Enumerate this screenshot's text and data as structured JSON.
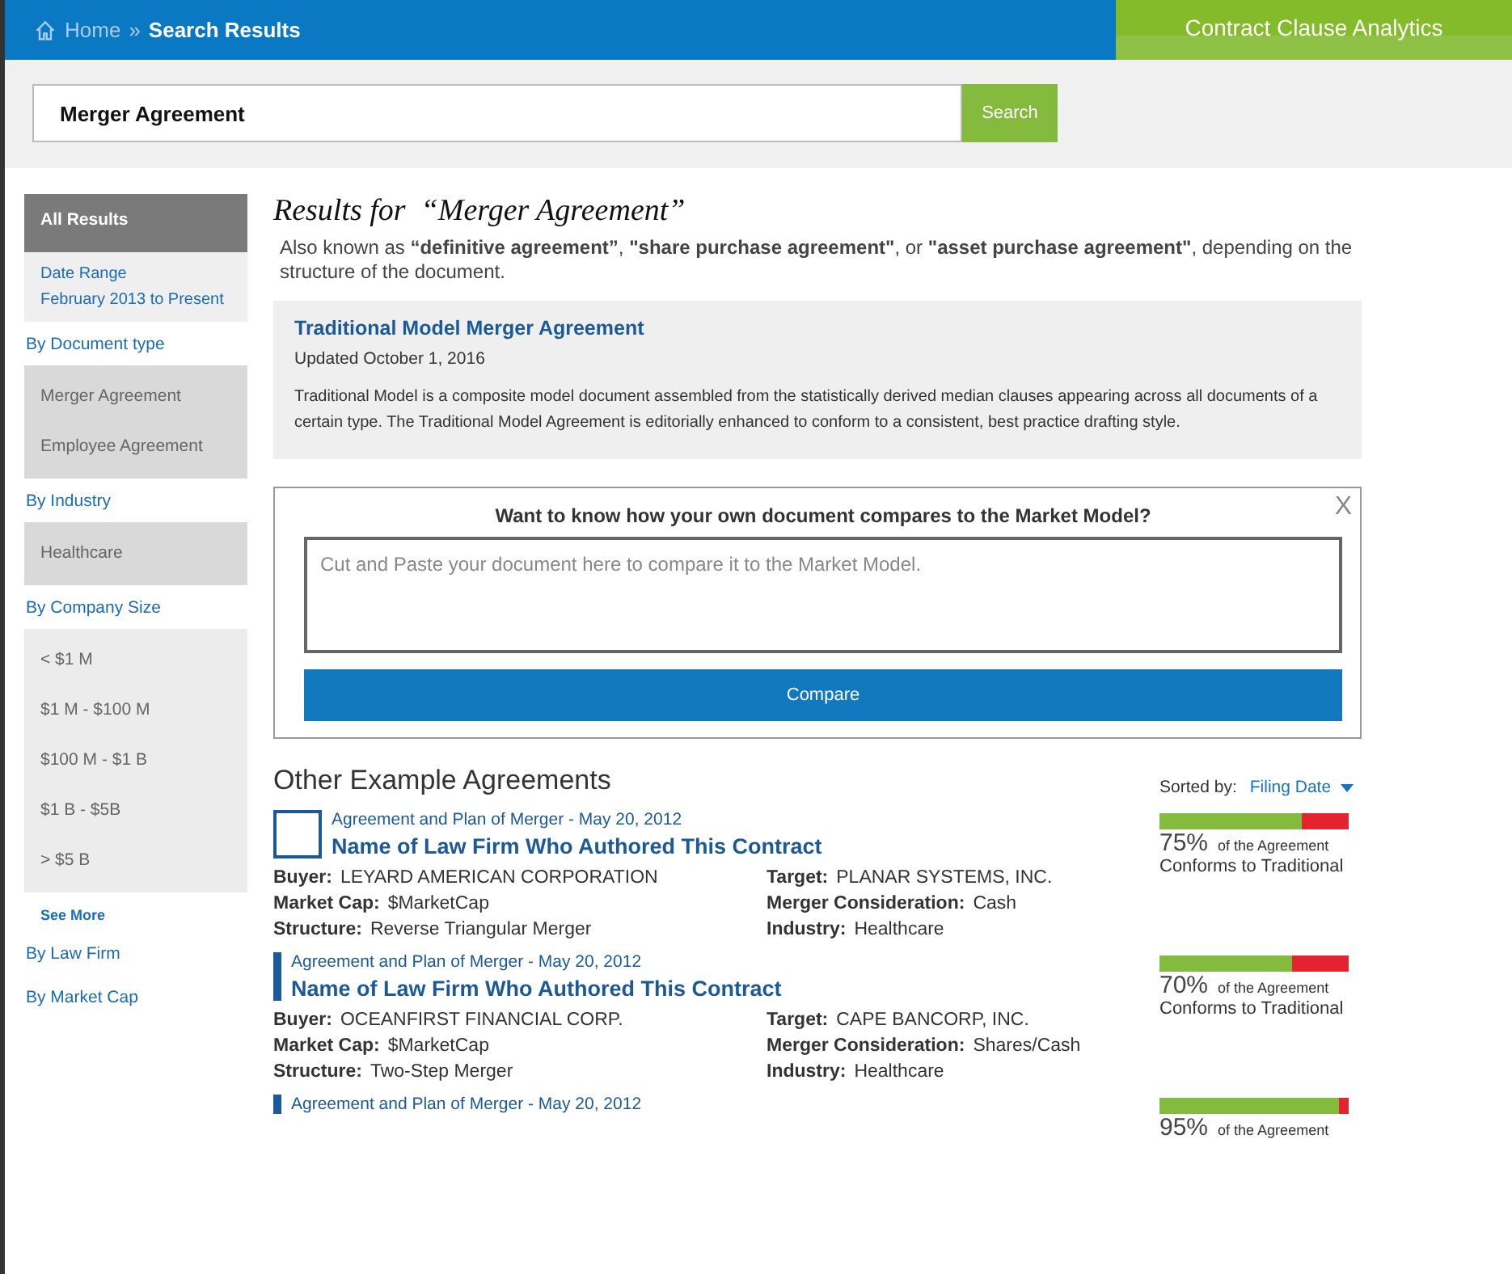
{
  "breadcrumb": {
    "home": "Home",
    "separator": "»",
    "current": "Search Results"
  },
  "app_title": "Contract Clause Analytics",
  "search": {
    "value": "Merger Agreement",
    "button": "Search"
  },
  "sidebar": [
    {
      "kind": "active",
      "label": "All Results"
    },
    {
      "kind": "panel",
      "lines": [
        "Date Range",
        "February 2013 to Present"
      ]
    },
    {
      "kind": "heading",
      "label": "By Document type"
    },
    {
      "kind": "group",
      "items": [
        "Merger Agreement",
        "Employee Agreement"
      ]
    },
    {
      "kind": "heading",
      "label": "By Industry"
    },
    {
      "kind": "group",
      "items": [
        "Healthcare"
      ]
    },
    {
      "kind": "heading",
      "label": "By Company Size"
    },
    {
      "kind": "list",
      "items": [
        "< $1 M",
        "$1 M - $100 M",
        "$100 M - $1 B",
        "$1 B - $5B",
        "> $5 B"
      ]
    },
    {
      "kind": "more",
      "label": "See More"
    },
    {
      "kind": "heading",
      "label": "By Law Firm"
    },
    {
      "kind": "heading",
      "label": "By Market Cap"
    }
  ],
  "results_title": {
    "prefix": "Results for",
    "query": "“Merger Agreement”"
  },
  "aka": "Also known as **“definitive agreement”**,  **\"share purchase agreement\"**,  or **\"asset purchase agreement\"**, depending on the structure of the document.",
  "model": {
    "title": "Traditional Model Merger Agreement",
    "updated": "Updated October 1, 2016",
    "description": "Traditional Model is a composite model document assembled from the statistically derived median clauses appearing across all documents of a certain type. The Traditional Model Agreement is editorially enhanced to conform to a consistent, best practice drafting style."
  },
  "compare": {
    "question": "Want to know how your own document compares to the Market Model?",
    "close": "X",
    "placeholder": "Cut and Paste your document here to compare it to the Market Model.",
    "button": "Compare"
  },
  "examples": {
    "title": "Other Example Agreements",
    "sort_label": "Sorted by:",
    "sort_value": "Filing Date",
    "items": [
      {
        "hovered": true,
        "meta": "Agreement and Plan of Merger - May 20, 2012",
        "title": "Name of Law Firm Who Authored This Contract",
        "level": 0.75,
        "percent": "75%",
        "of": "of the Agreement",
        "conforms": "Conforms to Traditional",
        "fields": [
          {
            "label": "Buyer:",
            "value": "LEYARD AMERICAN CORPORATION"
          },
          {
            "label": "Target:",
            "value": "PLANAR SYSTEMS, INC."
          },
          {
            "label": "Market Cap:",
            "value": "$MarketCap"
          },
          {
            "label": "Merger Consideration:",
            "value": "Cash"
          },
          {
            "label": "Structure:",
            "value": "Reverse Triangular Merger"
          },
          {
            "label": "Industry:",
            "value": "Healthcare"
          }
        ]
      },
      {
        "hovered": false,
        "meta": "Agreement and Plan of Merger - May 20, 2012",
        "title": "Name of Law Firm Who Authored This Contract",
        "level": 0.7,
        "percent": "70%",
        "of": "of the Agreement",
        "conforms": "Conforms to Traditional",
        "fields": [
          {
            "label": "Buyer:",
            "value": "OCEANFIRST FINANCIAL CORP."
          },
          {
            "label": "Target:",
            "value": "CAPE BANCORP, INC."
          },
          {
            "label": "Market Cap:",
            "value": "$MarketCap"
          },
          {
            "label": "Merger Consideration:",
            "value": "Shares/Cash"
          },
          {
            "label": "Structure:",
            "value": "Two-Step Merger"
          },
          {
            "label": "Industry:",
            "value": "Healthcare"
          }
        ]
      },
      {
        "hovered": false,
        "meta": "Agreement and Plan of Merger - May 20, 2012",
        "level": 0.95,
        "percent": "95%",
        "of": "of the Agreement"
      }
    ]
  }
}
